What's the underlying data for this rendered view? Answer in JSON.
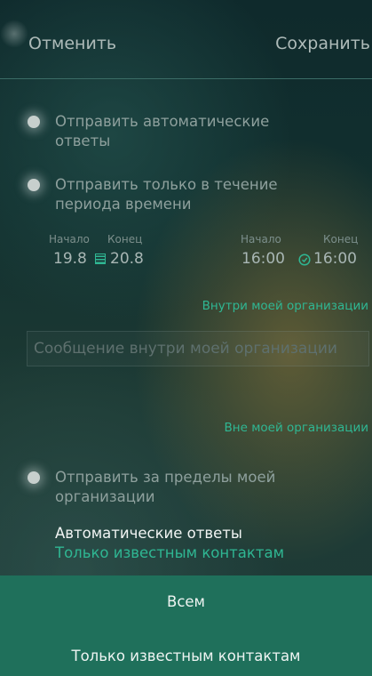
{
  "header": {
    "cancel": "Отменить",
    "save": "Сохранить"
  },
  "auto_reply": {
    "label": "Отправить автоматические ответы"
  },
  "time_period": {
    "label": "Отправить только в течение периода времени"
  },
  "dates": {
    "start_label": "Начало",
    "start_value": "19.8",
    "end_label": "Конец",
    "end_value": "20.8"
  },
  "times": {
    "start_label": "Начало",
    "start_value": "16:00",
    "end_label": "Конец",
    "end_value": "16:00"
  },
  "inside_org": {
    "label": "Внутри моей организации",
    "placeholder": "Сообщение внутри моей организации"
  },
  "outside_org": {
    "label": "Вне моей организации",
    "send_label": "Отправить за пределы моей организации"
  },
  "auto_replies": {
    "title": "Автоматические ответы",
    "value": "Только известным контактам"
  },
  "sheet": {
    "option_all": "Всем",
    "option_known": "Только известным контактам"
  },
  "colors": {
    "accent": "#2fb793",
    "sheet": "#1f705b"
  }
}
